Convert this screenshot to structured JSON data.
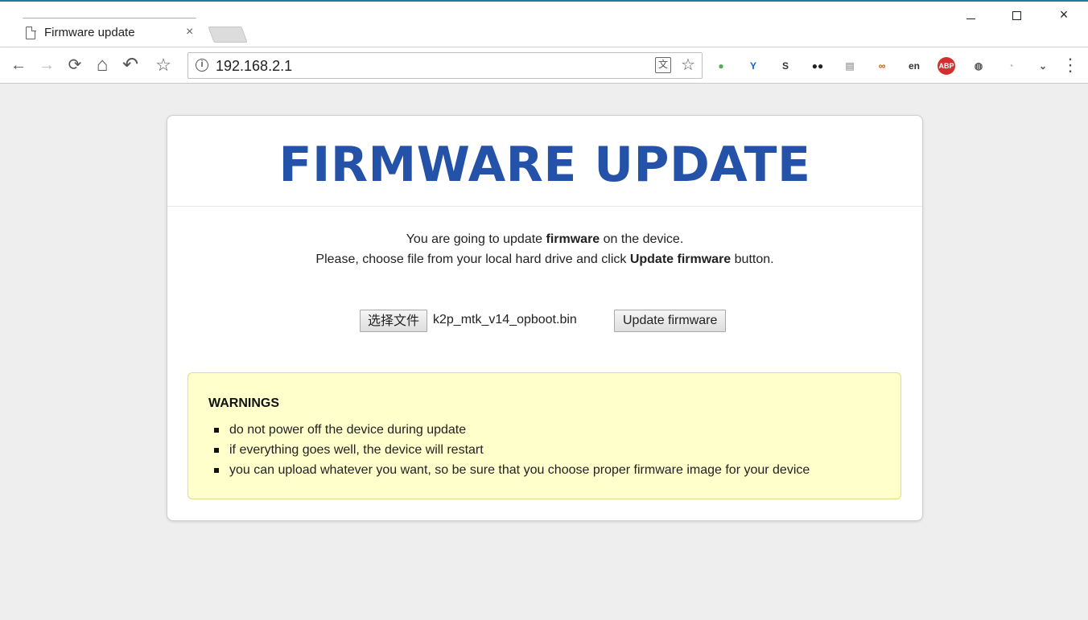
{
  "browser": {
    "tab": {
      "title": "Firmware update",
      "close_glyph": "×",
      "icon": "page-icon"
    },
    "window_controls": {
      "minimize": "minimize-icon",
      "maximize": "maximize-icon",
      "close": "×"
    },
    "toolbar": {
      "back": "←",
      "forward": "→",
      "reload": "⟳",
      "home": "⌂",
      "undo": "↶",
      "bookmark": "☆",
      "menu": "⋮",
      "url": "192.168.2.1",
      "info_glyph": "i",
      "translate_glyph": "文",
      "star_glyph": "☆"
    },
    "extensions": [
      {
        "name": "green-dot-extension-icon",
        "glyph": "●",
        "color": "#4caf50"
      },
      {
        "name": "y-extension-icon",
        "glyph": "Y",
        "color": "#1565c0"
      },
      {
        "name": "s-extension-icon",
        "glyph": "S",
        "color": "#333333"
      },
      {
        "name": "tampermonkey-icon",
        "glyph": "●●",
        "color": "#222222"
      },
      {
        "name": "reader-extension-icon",
        "glyph": "▤",
        "color": "#aaaaaa"
      },
      {
        "name": "infinity-extension-icon",
        "glyph": "∞",
        "color": "#e65100"
      },
      {
        "name": "translate-en-extension-icon",
        "glyph": "en",
        "color": "#333333"
      },
      {
        "name": "adblock-plus-icon",
        "glyph": "ABP",
        "color": "#d32f2f"
      },
      {
        "name": "bulb-extension-icon",
        "glyph": "◍",
        "color": "#555555"
      },
      {
        "name": "speed-extension-icon",
        "glyph": "◔",
        "color": "#bbbbbb"
      },
      {
        "name": "pocket-extension-icon",
        "glyph": "⌄",
        "color": "#555555"
      }
    ]
  },
  "page": {
    "title": "FIRMWARE UPDATE",
    "intro": {
      "line1_pre": "You are going to update ",
      "line1_bold": "firmware",
      "line1_post": " on the device.",
      "line2_pre": "Please, choose file from your local hard drive and click ",
      "line2_bold": "Update firmware",
      "line2_post": " button."
    },
    "form": {
      "choose_file_label": "选择文件",
      "file_name": "k2p_mtk_v14_opboot.bin",
      "update_button": "Update firmware"
    },
    "warnings": {
      "title": "WARNINGS",
      "items": [
        "do not power off the device during update",
        "if everything goes well, the device will restart",
        "you can upload whatever you want, so be sure that you choose proper firmware image for your device"
      ]
    }
  },
  "colors": {
    "title": "#2452a8",
    "warning_bg": "#ffffcc",
    "page_bg": "#eeeeee"
  }
}
